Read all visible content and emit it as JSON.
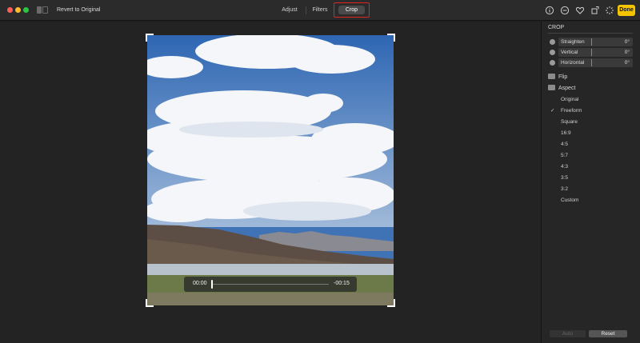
{
  "toolbar": {
    "revert_label": "Revert to Original",
    "tabs": [
      {
        "label": "Adjust"
      },
      {
        "label": "Filters"
      },
      {
        "label": "Crop"
      }
    ],
    "done_label": "Done",
    "icons": [
      "info-icon",
      "minus-circle-icon",
      "heart-icon",
      "rotate-icon",
      "magic-wand-icon"
    ]
  },
  "video": {
    "current_time": "00:00",
    "remaining_time": "-00:15",
    "progress": 0
  },
  "sidebar": {
    "title": "CROP",
    "sliders": [
      {
        "label": "Straighten",
        "value": "0°"
      },
      {
        "label": "Vertical",
        "value": "0°"
      },
      {
        "label": "Horizontal",
        "value": "0°"
      }
    ],
    "flip_label": "Flip",
    "aspect_label": "Aspect",
    "aspect_options": [
      "Original",
      "Freeform",
      "Square",
      "16:9",
      "4:5",
      "5:7",
      "4:3",
      "3:5",
      "3:2",
      "Custom"
    ],
    "selected_aspect": "Freeform",
    "check_mark": "✓",
    "auto_label": "Auto",
    "reset_label": "Reset"
  },
  "colors": {
    "accent_done": "#f5c400",
    "highlight": "#e0241f"
  }
}
